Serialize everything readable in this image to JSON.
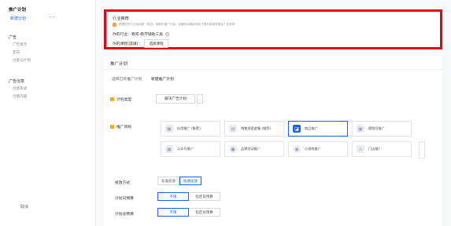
{
  "sidebar": {
    "title": "推广计划",
    "new_plan": "新建计划",
    "more": "···",
    "groups": [
      {
        "label": "广告",
        "items": [
          "广告单元",
          "定向",
          "创意与计划"
        ]
      },
      {
        "label": "广告创意",
        "items": [
          "创意形式",
          "创意内容"
        ]
      }
    ],
    "cancel": "取消"
  },
  "industry": {
    "title": "行业推荐",
    "warning": "根据您的行业及填报（类目）推荐的推广方案，准确的填报能有利于提升推荐效果及广告效率",
    "industry_label": "你的行业：教育-教学辅助工具",
    "course_label": "你的课程(选填)：",
    "select_course": "选择课程"
  },
  "plan": {
    "header": "推广计划",
    "tab_existing": "选择已有推广计划",
    "tab_new": "新建推广计划",
    "type_label": "计划类型",
    "type_value": "解决广告计划",
    "target_label": "推广目标",
    "targets": [
      {
        "label": "应用推广 (推荐)",
        "icon": "▣"
      },
      {
        "label": "销售线索收集 (推荐)",
        "icon": "▤"
      },
      {
        "label": "商品推广",
        "icon": "◪"
      },
      {
        "label": "视频号推广",
        "icon": "▣"
      },
      {
        "label": "公众号推广",
        "icon": "▣"
      },
      {
        "label": "品牌活动推广",
        "icon": "●"
      },
      {
        "label": "小游戏推广",
        "icon": "◉"
      },
      {
        "label": "门店推广",
        "icon": "⌂"
      }
    ],
    "scroll_arrow": "›",
    "delivery_label": "投放方式",
    "delivery_options": [
      "标准投放",
      "加速投放"
    ],
    "daily_budget_label": "计划日预算",
    "daily_budget_options": [
      "不限",
      "指定日预算"
    ],
    "total_budget_label": "计划总预算",
    "total_budget_options": [
      "不限",
      "指定总预算"
    ]
  },
  "colors": {
    "accent": "#1a5fff",
    "highlight_border": "#e60012",
    "warn": "#f5a623"
  }
}
